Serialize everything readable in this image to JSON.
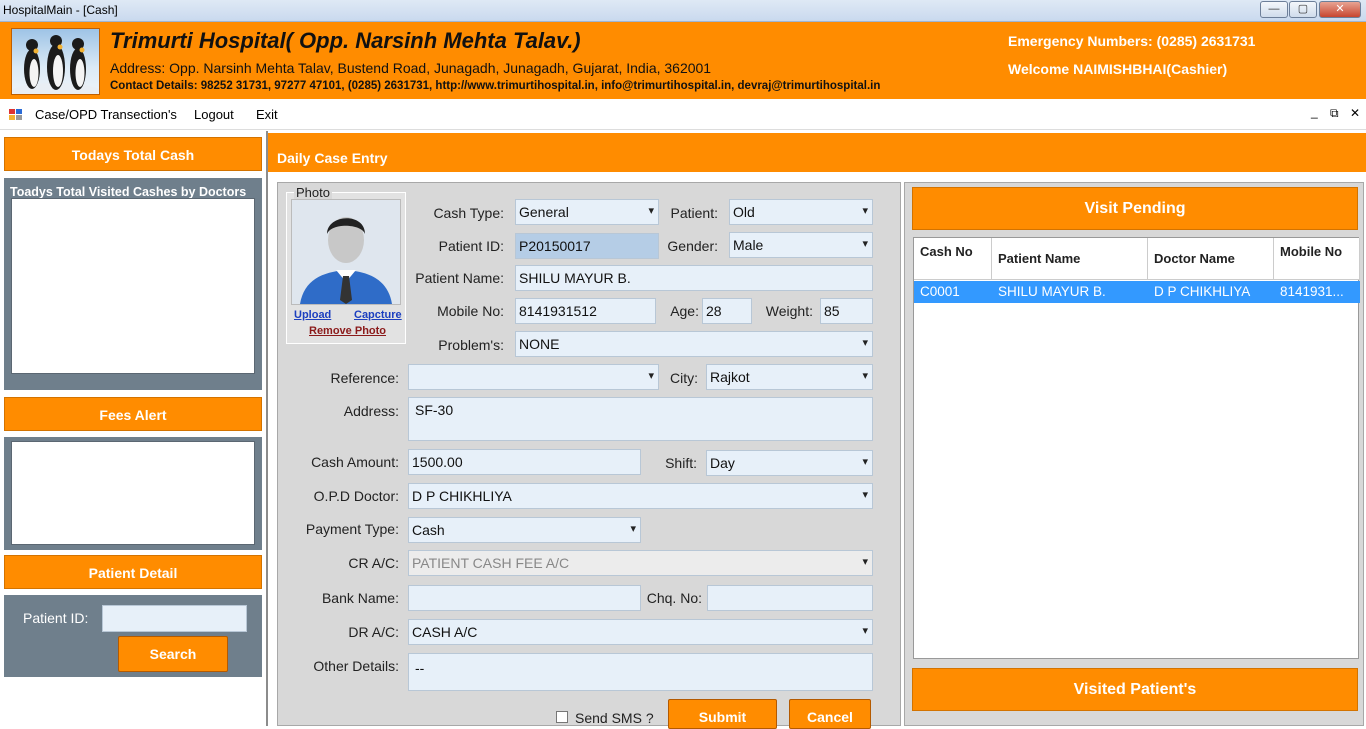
{
  "window": {
    "title": "HospitalMain - [Cash]",
    "min": "—",
    "max": "▢",
    "close": "✕"
  },
  "header": {
    "hospital_name": "Trimurti Hospital( Opp. Narsinh Mehta Talav.)",
    "address": "Address: Opp. Narsinh Mehta Talav, Bustend Road, Junagadh, Junagadh, Gujarat, India, 362001",
    "contact": "Contact Details: 98252 31731, 97277 47101, (0285) 2631731, http://www.trimurtihospital.in, info@trimurtihospital.in, devraj@trimurtihospital.in",
    "emergency": "Emergency Numbers: (0285) 2631731",
    "welcome": "Welcome NAIMISHBHAI(Cashier)",
    "accent": "#ff8c00"
  },
  "menu": {
    "items": [
      "Case/OPD Transection's",
      "Logout",
      "Exit"
    ],
    "mdi_min": "_",
    "mdi_restore": "⧉",
    "mdi_close": "✕"
  },
  "left": {
    "todays_total_cash": "Todays Total Cash",
    "visited_title": "Toadys Total Visited Cashes by Doctors",
    "fees_alert": "Fees Alert",
    "patient_detail": "Patient Detail",
    "patient_id_label": "Patient ID:",
    "patient_id_value": "",
    "search": "Search"
  },
  "entry": {
    "title": "Daily Case Entry",
    "photo": {
      "legend": "Photo",
      "upload": "Upload",
      "capture": "Capcture",
      "remove": "Remove Photo"
    },
    "labels": {
      "cash_type": "Cash Type:",
      "patient": "Patient:",
      "patient_id": "Patient ID:",
      "gender": "Gender:",
      "patient_name": "Patient Name:",
      "mobile": "Mobile No:",
      "age": "Age:",
      "weight": "Weight:",
      "problems": "Problem's:",
      "reference": "Reference:",
      "city": "City:",
      "address": "Address:",
      "cash_amount": "Cash Amount:",
      "shift": "Shift:",
      "opd_doctor": "O.P.D Doctor:",
      "payment_type": "Payment Type:",
      "cr_ac": "CR A/C:",
      "bank_name": "Bank Name:",
      "chq_no": "Chq. No:",
      "dr_ac": "DR A/C:",
      "other_details": "Other Details:",
      "send_sms": "Send SMS ?"
    },
    "values": {
      "cash_type": "General",
      "patient": "Old",
      "patient_id": "P20150017",
      "gender": "Male",
      "patient_name": "SHILU MAYUR B.",
      "mobile": "8141931512",
      "age": "28",
      "weight": "85",
      "problems": "NONE",
      "reference": "",
      "city": "Rajkot",
      "address": "SF-30",
      "cash_amount": "1500.00",
      "shift": "Day",
      "opd_doctor": "D P CHIKHLIYA",
      "payment_type": "Cash",
      "cr_ac": "PATIENT CASH FEE A/C",
      "bank_name": "",
      "chq_no": "",
      "dr_ac": "CASH A/C",
      "other_details": "--"
    },
    "submit": "Submit",
    "cancel": "Cancel"
  },
  "visit_pending": {
    "title": "Visit Pending",
    "columns": [
      "Cash No",
      "Patient Name",
      "Doctor Name",
      "Mobile No"
    ],
    "rows": [
      [
        "C0001",
        "SHILU MAYUR B.",
        "D P CHIKHLIYA",
        "8141931..."
      ]
    ],
    "visited_title": "Visited Patient's"
  }
}
